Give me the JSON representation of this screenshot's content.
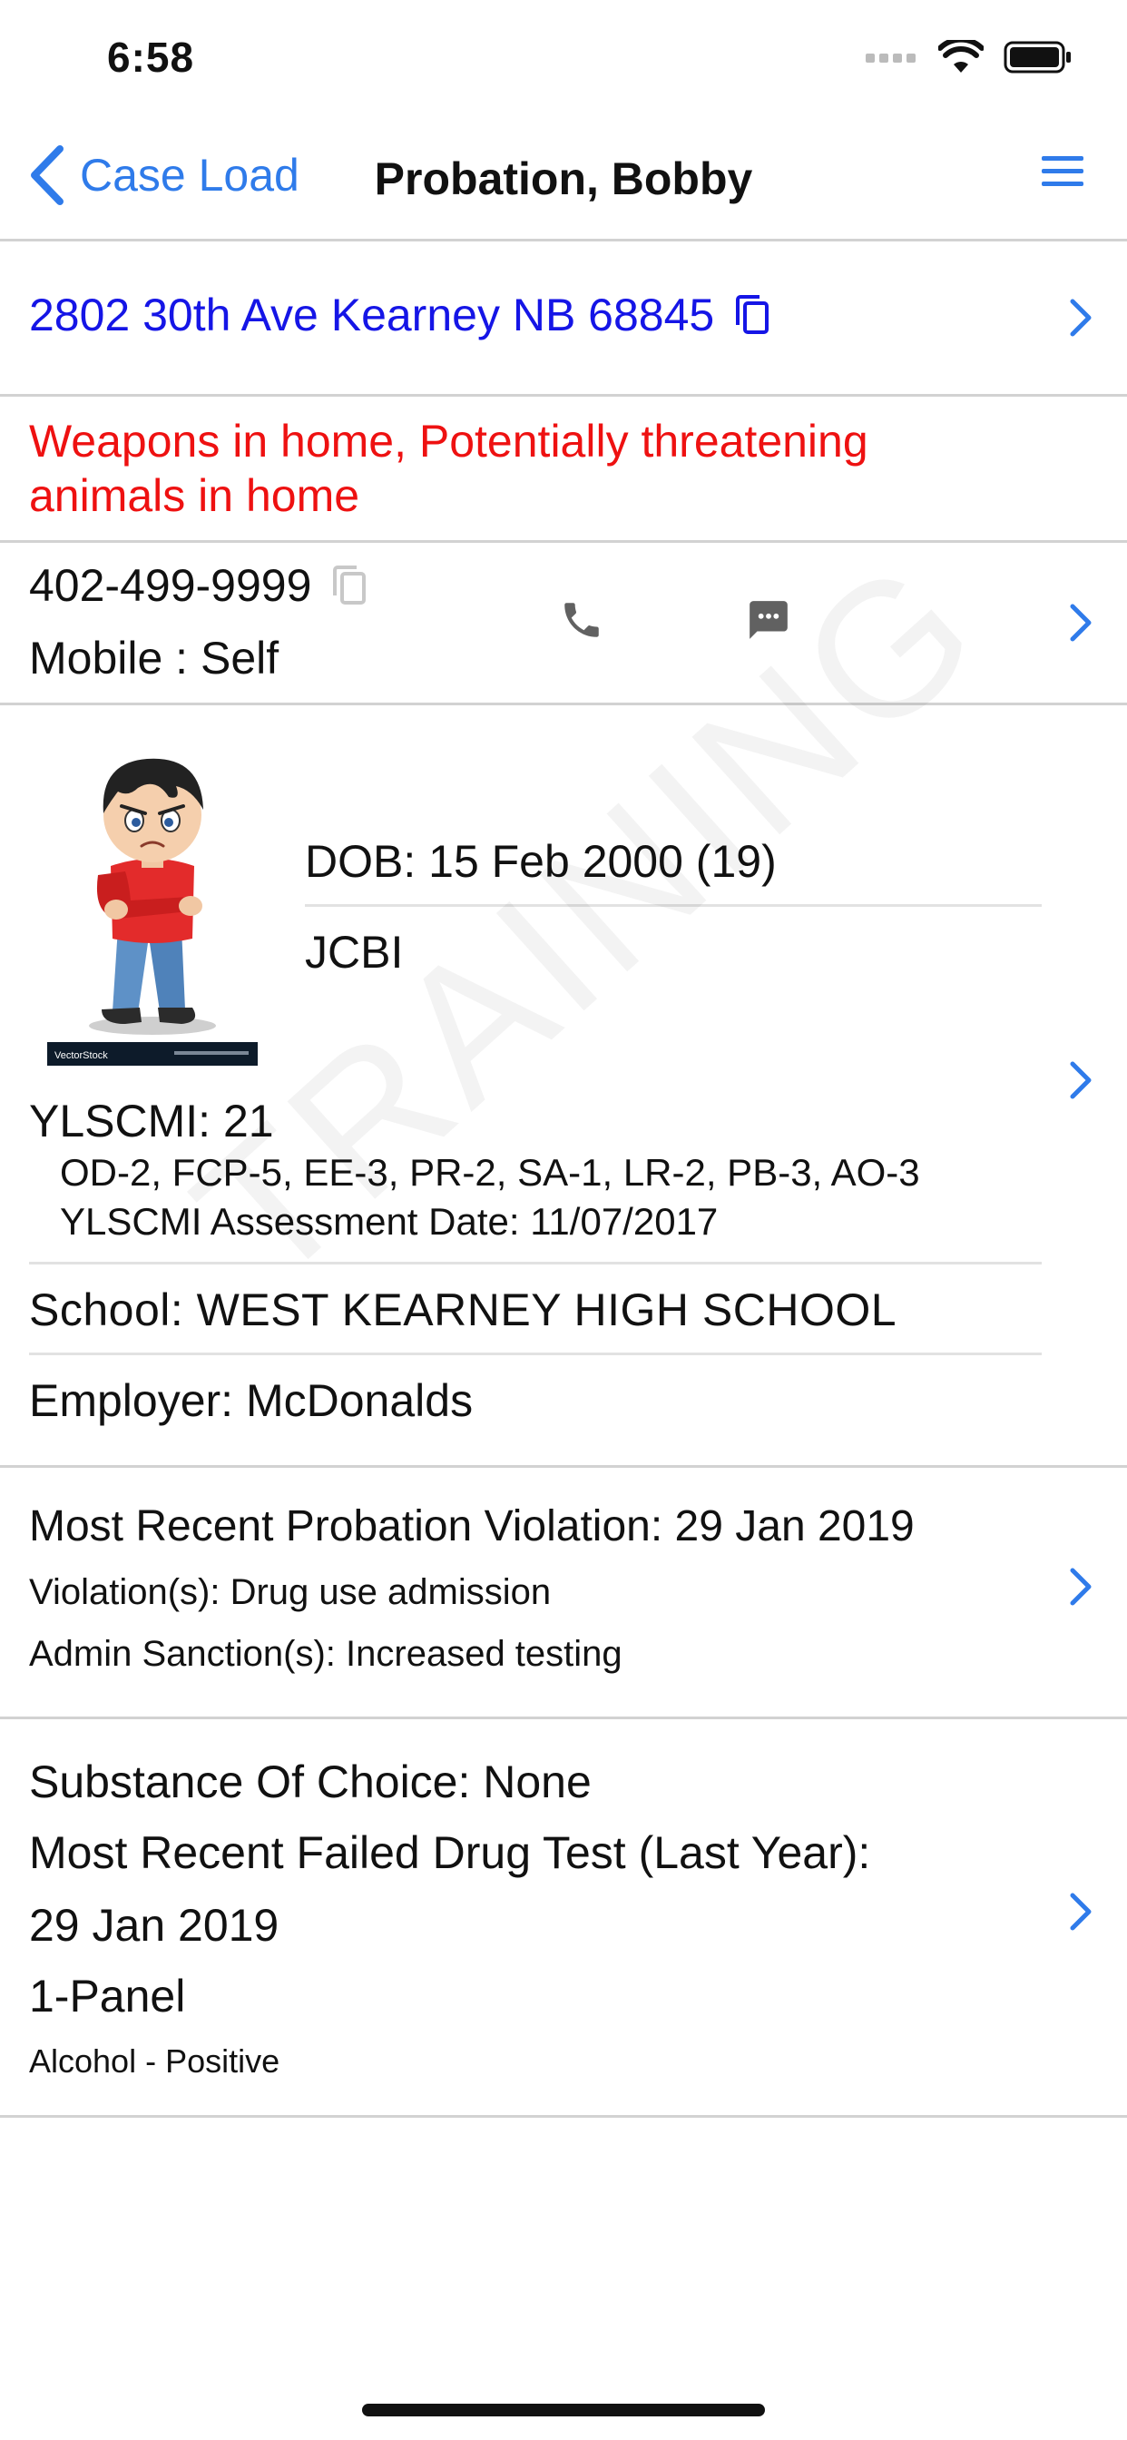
{
  "status_bar": {
    "time": "6:58"
  },
  "nav": {
    "back_label": "Case Load",
    "title": "Probation, Bobby"
  },
  "address": {
    "text": "2802 30th Ave Kearney NB 68845"
  },
  "warnings": {
    "text": "Weapons in home, Potentially threatening animals in home"
  },
  "phone": {
    "number": "402-499-9999",
    "type": "Mobile : Self"
  },
  "profile": {
    "dob": "DOB: 15 Feb 2000 (19)",
    "jurisdiction": "JCBI",
    "ylscmi": "YLSCMI: 21",
    "ylscmi_scores": "OD-2, FCP-5, EE-3, PR-2, SA-1, LR-2, PB-3, AO-3",
    "ylscmi_date": "YLSCMI Assessment Date: 11/07/2017",
    "school": "School: WEST KEARNEY HIGH SCHOOL",
    "employer": "Employer: McDonalds",
    "avatar_mark": "VectorStock"
  },
  "violation": {
    "title": "Most Recent Probation Violation: 29 Jan 2019",
    "violations": "Violation(s): Drug use admission",
    "sanctions": "Admin Sanction(s): Increased testing"
  },
  "drug_test": {
    "substance": "Substance Of Choice: None",
    "label": "Most Recent Failed Drug Test (Last Year):",
    "date": "29 Jan 2019",
    "panel": "1-Panel",
    "result": "Alcohol - Positive"
  },
  "watermark": {
    "text": "TRAINING"
  },
  "colors": {
    "accent": "#2f7bea",
    "address_link": "#1515e6",
    "warning": "#ee1111",
    "divider": "#d2d2d2"
  }
}
